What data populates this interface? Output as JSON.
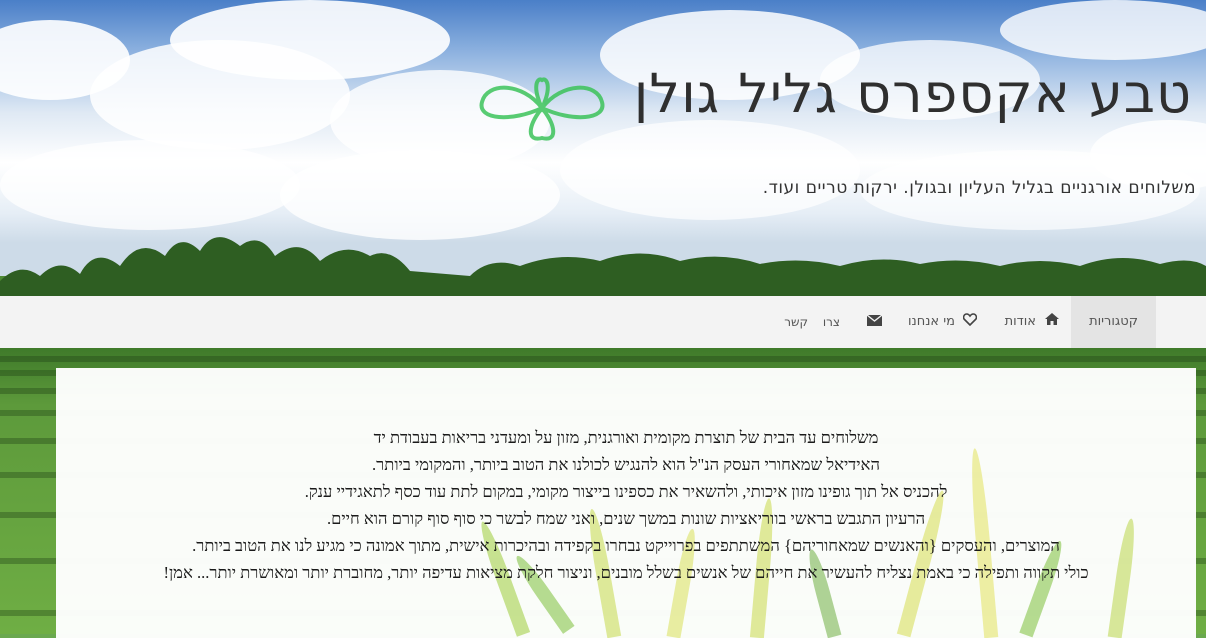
{
  "site": {
    "title": "טבע אקספרס גליל גולן",
    "description": "משלוחים אורגניים בגליל העליון ובגולן. ירקות טריים ועוד."
  },
  "nav": {
    "items": [
      {
        "label": "קטגוריות",
        "icon": "",
        "active": true
      },
      {
        "label": "אודות",
        "icon": "home-icon"
      },
      {
        "label": "מי אנחנו",
        "icon": "heart-icon"
      },
      {
        "label": "",
        "icon": "envelope-icon"
      },
      {
        "label": "צרו",
        "icon": ""
      },
      {
        "label": "קשר",
        "icon": ""
      }
    ]
  },
  "content": {
    "lines": [
      "משלוחים עד הבית של תוצרת מקומית ואורגנית, מזון על ומעדני בריאות בעבודת יד",
      "האידיאל שמאחורי העסק הנ\"ל הוא להנגיש לכולנו את הטוב ביותר, והמקומי ביותר.",
      "להכניס אל תוך גופינו מזון איכותי, ולהשאיר את כספינו בייצור מקומי, במקום לתת עוד כסף לתאגידיי ענק.",
      "הרעיון התגבש בראשי בווריאציות שונות במשך שנים, ואני שמח לבשר כי סוף סוף קורם הוא חיים.",
      "המוצרים, והעסקים {והאנשים שמאחוריהם} המשתתפים בפרוייקט נבחרו בקפידה ובהיכרות אישית, מתוך אמונה כי מגיע לנו את הטוב ביותר.",
      "כולי תקווה ותפילה כי באמת נצליח להעשיר את חייהם של אנשים בשלל מובנים, וניצור חלקת מציאות עדיפה יותר, מחוברת יותר ומאושרת יותר... אמן!"
    ]
  },
  "colors": {
    "logo": "#3cc35a",
    "nav_bg": "#f3f3f3",
    "title": "#2f2f2f"
  }
}
